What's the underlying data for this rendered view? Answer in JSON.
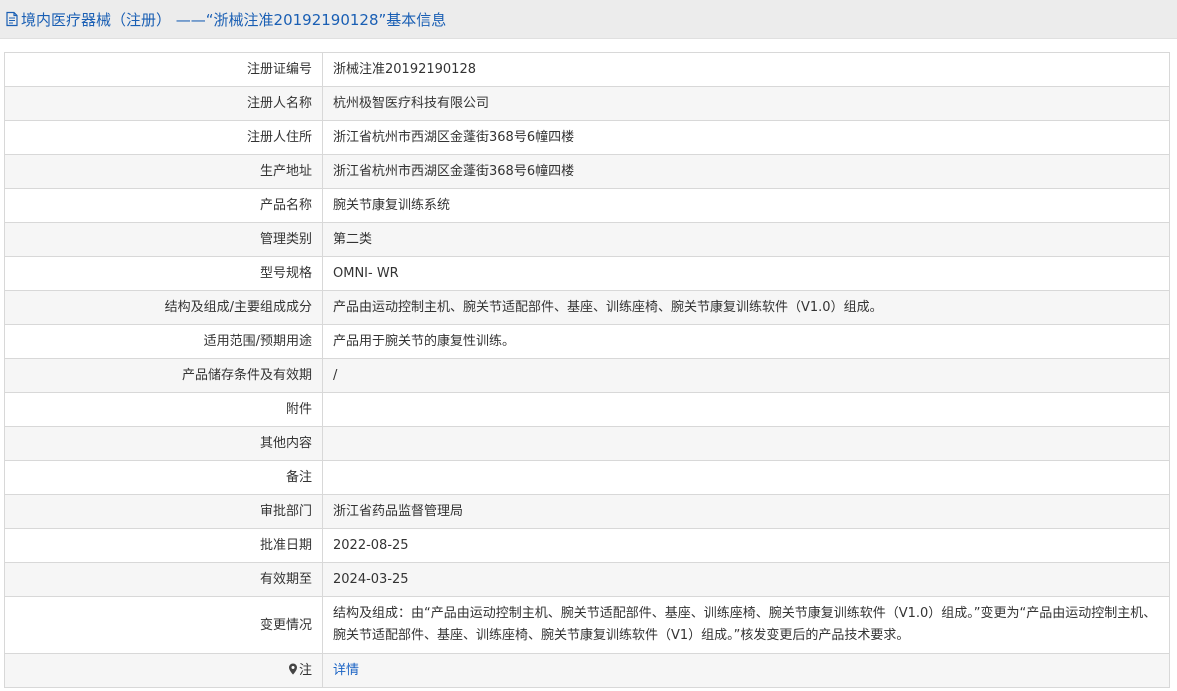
{
  "header": {
    "title": "境内医疗器械（注册）  ——“浙械注准20192190128”基本信息"
  },
  "rows": [
    {
      "label": "注册证编号",
      "value": "浙械注准20192190128"
    },
    {
      "label": "注册人名称",
      "value": "杭州极智医疗科技有限公司"
    },
    {
      "label": "注册人住所",
      "value": "浙江省杭州市西湖区金蓬街368号6幢四楼"
    },
    {
      "label": "生产地址",
      "value": "浙江省杭州市西湖区金蓬街368号6幢四楼"
    },
    {
      "label": "产品名称",
      "value": "腕关节康复训练系统"
    },
    {
      "label": "管理类别",
      "value": "第二类"
    },
    {
      "label": "型号规格",
      "value": "OMNI- WR"
    },
    {
      "label": "结构及组成/主要组成成分",
      "value": "产品由运动控制主机、腕关节适配部件、基座、训练座椅、腕关节康复训练软件（V1.0）组成。"
    },
    {
      "label": "适用范围/预期用途",
      "value": "产品用于腕关节的康复性训练。"
    },
    {
      "label": "产品储存条件及有效期",
      "value": "/"
    },
    {
      "label": "附件",
      "value": ""
    },
    {
      "label": "其他内容",
      "value": ""
    },
    {
      "label": "备注",
      "value": ""
    },
    {
      "label": "审批部门",
      "value": "浙江省药品监督管理局"
    },
    {
      "label": "批准日期",
      "value": "2022-08-25"
    },
    {
      "label": "有效期至",
      "value": "2024-03-25"
    },
    {
      "label": "变更情况",
      "value": "结构及组成：由“产品由运动控制主机、腕关节适配部件、基座、训练座椅、腕关节康复训练软件（V1.0）组成。”变更为“产品由运动控制主机、腕关节适配部件、基座、训练座椅、腕关节康复训练软件（V1）组成。”核发变更后的产品技术要求。"
    }
  ],
  "note": {
    "label": "注",
    "link": "详情"
  }
}
